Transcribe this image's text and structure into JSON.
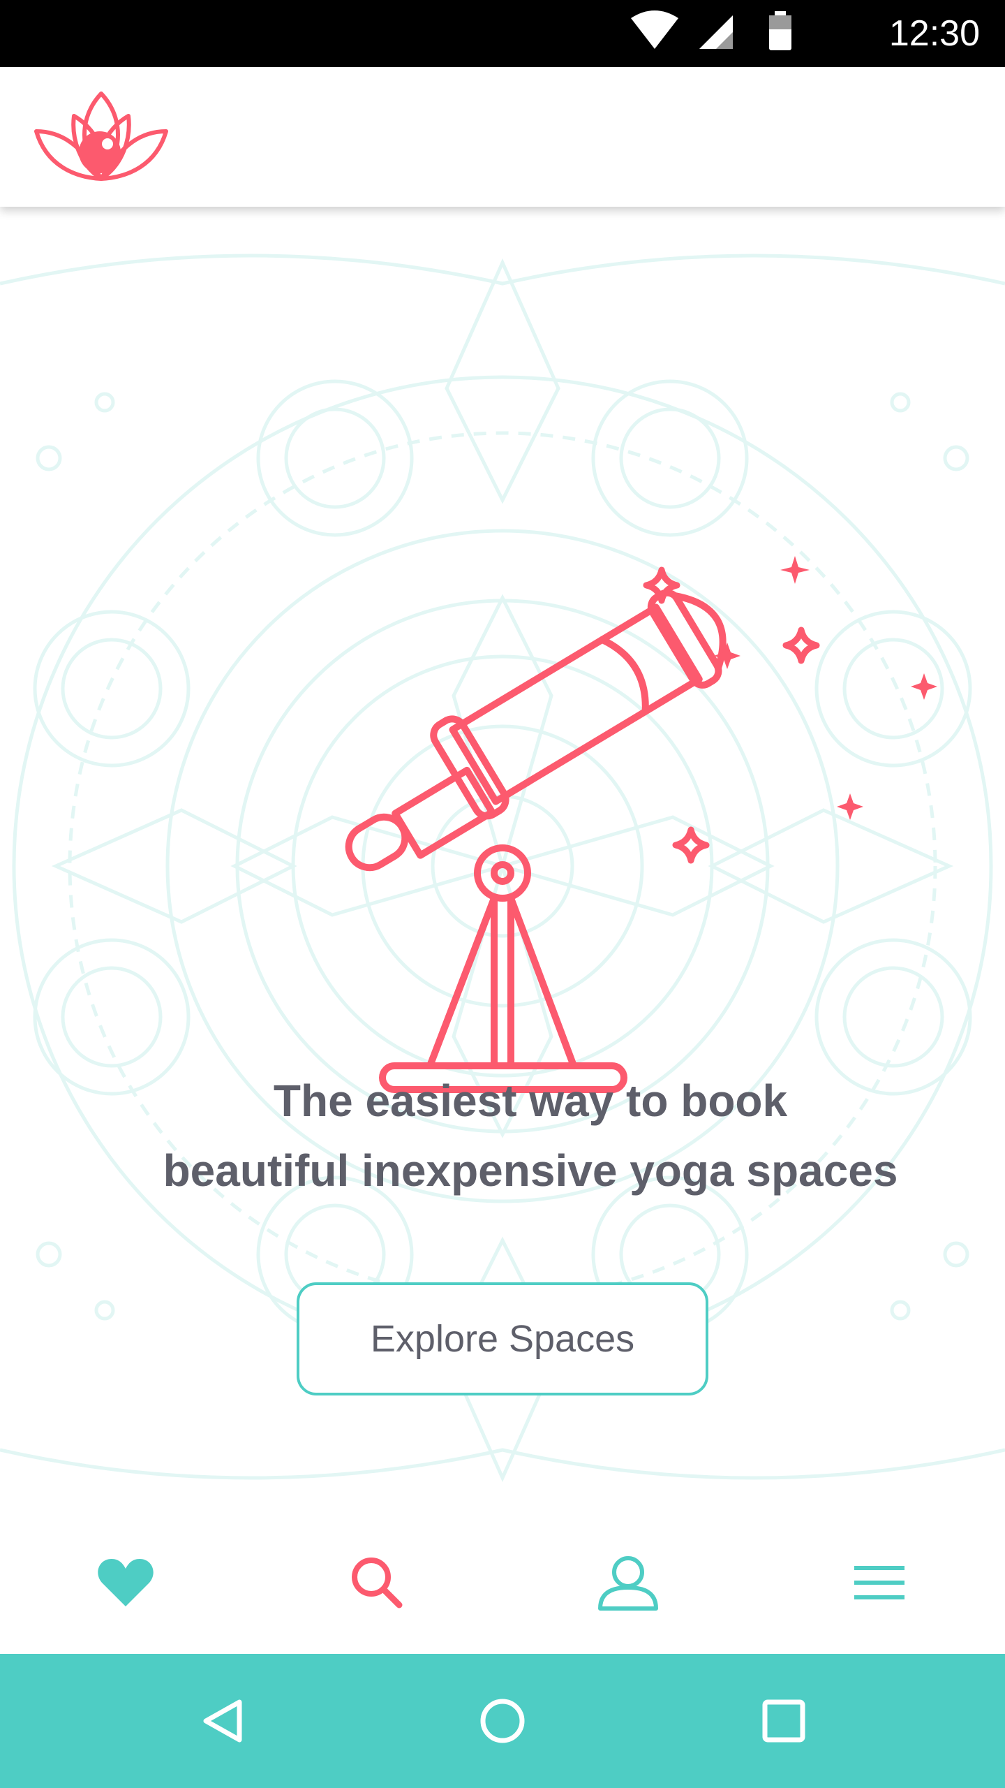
{
  "status_bar": {
    "time": "12:30",
    "icons": [
      "wifi-icon",
      "cellular-signal-icon",
      "battery-icon"
    ]
  },
  "header": {
    "logo": "lotus-logo-icon"
  },
  "hero": {
    "illustration": "telescope-with-stars",
    "headline_line1": "The easiest way to book",
    "headline_line2": "beautiful inexpensive yoga spaces",
    "button_label": "Explore Spaces"
  },
  "bottom_nav": {
    "items": [
      {
        "icon": "heart-icon",
        "active": false
      },
      {
        "icon": "search-icon",
        "active": true
      },
      {
        "icon": "user-icon",
        "active": false
      },
      {
        "icon": "menu-icon",
        "active": false
      }
    ]
  },
  "system_nav": {
    "buttons": [
      "back-icon",
      "home-icon",
      "recents-icon"
    ]
  },
  "colors": {
    "accent": "#fc5a6e",
    "teal": "#4ecdc4",
    "text": "#5e5f6a",
    "mandala": "#e2f6f4"
  }
}
